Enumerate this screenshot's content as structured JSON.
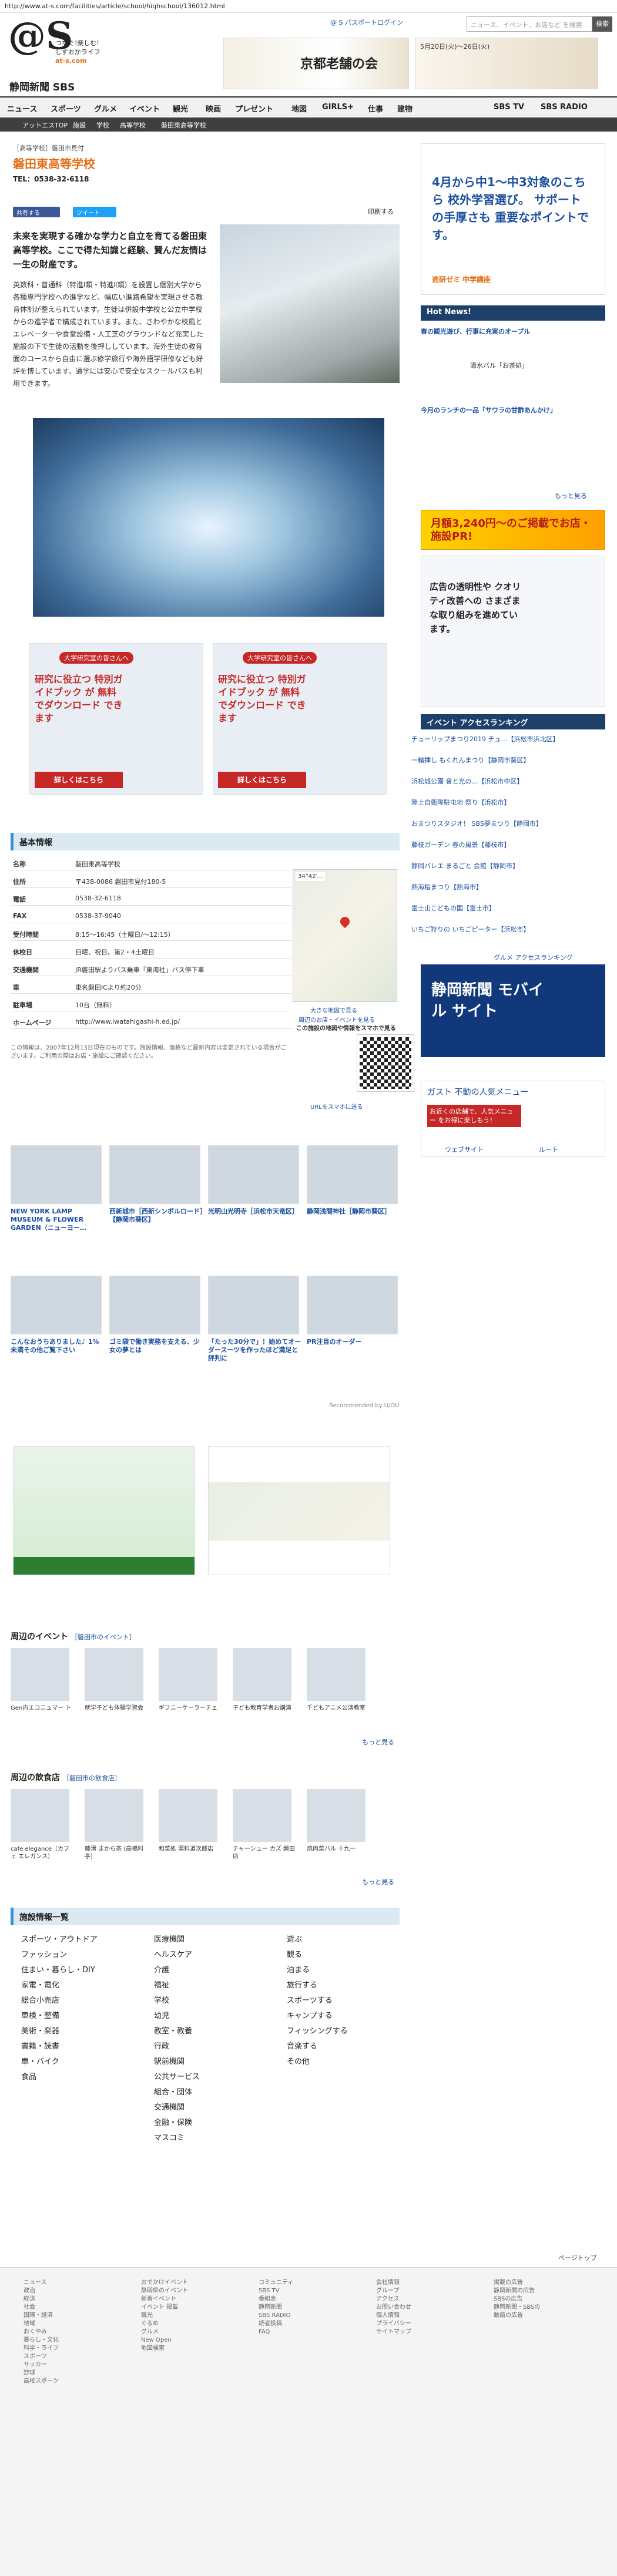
{
  "url": "http://www.at-s.com/facilities/article/school/highschool/136012.html",
  "header": {
    "logo": "@S",
    "tagline": [
      "つなぐ!楽しむ!",
      "しずおかライフ",
      "at-s.com"
    ],
    "newspaper": "静岡新聞 SBS",
    "passport": "@ S パスポートログイン",
    "search_placeholder": "ニュース、イベント、お店など を検索",
    "search_button": "検索",
    "banner1_text": "京都老舗の会",
    "banner2_text": "5月20日(火)〜26日(火)"
  },
  "nav": [
    "ニュース",
    "スポーツ",
    "グルメ",
    "イベント",
    "観光",
    "映画",
    "プレゼント",
    "地図",
    "GIRLS+",
    "仕事",
    "建物",
    "SBS TV",
    "SBS RADIO"
  ],
  "breadcrumb": [
    "アットエスTOP",
    "施設",
    "学校",
    "高等学校",
    "磐田東高等学校"
  ],
  "school": {
    "category": "［高等学校］磐田市見付",
    "name": "磐田東高等学校",
    "tel_label": "TEL：0538-32-6118",
    "share_fb": "共有する",
    "share_tw": "ツイート",
    "print": "印刷する",
    "lead": "未来を実現する確かな学力と自立を育てる磐田東高等学校。ここで得た知識と経験、賢んだ友情は一生の財産です。",
    "body": "英数科・普通科（特進Ⅰ類・特進Ⅱ類）を設置し個別大学から各種専門学校への進学など、幅広い進路希望を実現させる教育体制が整えられています。生徒は併設中学校と公立中学校からの進学者で構成されています。また、さわやかな校風とエレベーターや食堂設備・人工芝のグラウンドなど充実した施設の下で生徒の活動を後押ししています。海外生徒の教育面のコースから自由に選ぶ修学旅行や海外語学研修なども好評を博しています。通学には安心で安全なスクールバスも利用できます。"
  },
  "ad_left": {
    "headline": "大学研究室の皆さんへ",
    "body": "研究に役立つ 特別ガイドブック が 無料でダウンロード できます",
    "button": "詳しくはこちら"
  },
  "basic": {
    "heading": "基本情報",
    "rows": [
      {
        "k": "名称",
        "v": "磐田東高等学校"
      },
      {
        "k": "住所",
        "v": "〒438-0086 磐田市見付180-5"
      },
      {
        "k": "電話",
        "v": "0538-32-6118"
      },
      {
        "k": "FAX",
        "v": "0538-37-9040"
      },
      {
        "k": "受付時間",
        "v": "8:15〜16:45（土曜日/〜12:15）"
      },
      {
        "k": "休校日",
        "v": "日曜、祝日、第2・4土曜日"
      },
      {
        "k": "交通機関",
        "v": "JR磐田駅よりバス乗車「東海社」バス停下車"
      },
      {
        "k": "車",
        "v": "東名磐田ICより約20分"
      },
      {
        "k": "駐車場",
        "v": "10台（無料）"
      },
      {
        "k": "ホームページ",
        "v": "http://www.iwatahigashi-h.ed.jp/"
      }
    ],
    "note": "この情報は、2007年12月13日現在のものです。施設情報、価格など最新内容は変更されている場合がございます。ご利用の際はお店・施設にご確認ください。",
    "map_temp": "34°42′...",
    "map_links": [
      "大きな地図で見る",
      "周辺のお店・イベントを見る"
    ],
    "qr_caption": "この施設の地図や情報をスマホで見る",
    "qr_link": "URLをスマホに送る"
  },
  "recommend": [
    {
      "t": "NEW YORK LAMP MUSEUM & FLOWER GARDEN（ニューヨー…"
    },
    {
      "t": "西新城市［西新シンボルロード］【静岡市葵区】"
    },
    {
      "t": "光明山光明寺［浜松市天竜区］"
    },
    {
      "t": "静岡浅間神社［静岡市葵区］"
    },
    {
      "t": "こんなおうちありました♪ 1%未満その他ご覧下さい"
    },
    {
      "t": "ゴミ袋で働き実務を支える、少女の夢とは"
    },
    {
      "t": "「たった30分で」！始めてオーダースーツを作ったほど満足と評判に"
    },
    {
      "t": "PR注目のオーダー"
    }
  ],
  "recommend_by": "Recommended by U/OU",
  "events_heading": "周辺のイベント",
  "events_sub": "［磐田市のイベント］",
  "events": [
    "Gen内エコニュマー ト",
    "就学子ども体験学習会",
    "ギフニーケーラーチェ",
    "子ども教育学者お講演",
    "千どもアニメ公演教室"
  ],
  "shops_heading": "周辺の飲食店",
  "shops_sub": "［磐田市の飲食店］",
  "shops": [
    "cafe elegance（カフェ エレガンス）",
    "藤滑 まから茶 (高橋料亭)",
    "和菜処 湯料道次郎店",
    "チャーシュー カズ 磐田店",
    "焼肉菜バル 十九一"
  ],
  "more": "もっと見る",
  "facility_heading": "施設情報一覧",
  "facility_cols": [
    [
      "スポーツ・アウトドア",
      "ファッション",
      "住まい・暮らし・DIY",
      "家電・電化",
      "総合小売店",
      "車検・整備",
      "美術・楽器",
      "書籍・読書",
      "車・バイク",
      "食品"
    ],
    [
      "医療機関",
      "ヘルスケア",
      "介護",
      "福祉",
      "学校",
      "幼児",
      "教室・教養",
      "行政",
      "駅前機関",
      "公共サービス",
      "組合・団体",
      "交通機関",
      "金融・保険",
      "マスコミ"
    ],
    [
      "遊ぶ",
      "観る",
      "泊まる",
      "旅行する",
      "スポーツする",
      "キャンプする",
      "フィッシングする",
      "音楽する",
      "その他"
    ]
  ],
  "sidebar": {
    "ad1": "4月から中1〜中3対象のこちら 校外学習選び。 サポートの手厚さも 重要なポイントです。",
    "ad1_link": "進研ゼミ 中学講座",
    "hotnews": "Hot News!",
    "hot1": "春の観光遊び、行事に充実のオープル",
    "hot2": "今月のランチの一品「サワラの甘酢あんかけ」",
    "hot3": "清水バル「お茶処」",
    "cta": "月額3,240円〜のご掲載でお店・施設PR!",
    "ad2": "広告の透明性や クオリティ改善への さまざまな取り組みを進めています。",
    "ranking_title": "イベント アクセスランキング",
    "ranking": [
      "チューリップまつり2019 チュ…【浜松市浜北区】",
      "一輪挿し もくれんまつり【静岡市葵区】",
      "浜松城公園 音と光の…【浜松市中区】",
      "陸上自衛隊駐屯地 祭り【浜松市】",
      "おまつりスタジオ！ SBS夢まつり【静岡市】",
      "藤枝ガーデン 春の風景【藤枝市】",
      "静岡バレエ まるごと 会館【静岡市】",
      "熱海桜まつり【熱海市】",
      "富士山こどもの国【富士市】",
      "いちご狩りの いちごピーター【浜松市】"
    ],
    "ranking_more": "グルメ アクセスランキング",
    "mobile": "静岡新聞 モバイル サイト",
    "gas": "ガスト 不動の人気メニュー",
    "gas_sub": "お近くの店舗で、人気メニュー をお得に楽しもう！",
    "gas_web": "ウェブサイト",
    "gas_route": "ルート"
  },
  "pagetop": "ページトップ",
  "footer_cols": [
    [
      "ニュース",
      "政治",
      "経済",
      "社会",
      "国際・経済",
      "地域",
      "おくやみ",
      "暮らし・文化",
      "科学・ライフ",
      "スポーツ",
      "サッカー",
      "野球",
      "高校スポーツ"
    ],
    [
      "おでかけイベント",
      "静岡県のイベント",
      "新着イベント",
      "イベント 掲載",
      "観光",
      "ぐるめ",
      "グルメ",
      "New Open",
      "地図検索"
    ],
    [
      "コミュニティ",
      "SBS TV",
      "番組表",
      "静岡新聞",
      "SBS RADIO",
      "読者投稿",
      "FAQ"
    ],
    [
      "会社情報",
      "グループ",
      "アクセス",
      "お問い合わせ",
      "個人情報",
      "プライバシー",
      "サイトマップ"
    ],
    [
      "掲載の広告",
      "静岡新聞の広告",
      "SBSの広告",
      "静岡新聞・SBSの",
      "動画の広告"
    ]
  ]
}
